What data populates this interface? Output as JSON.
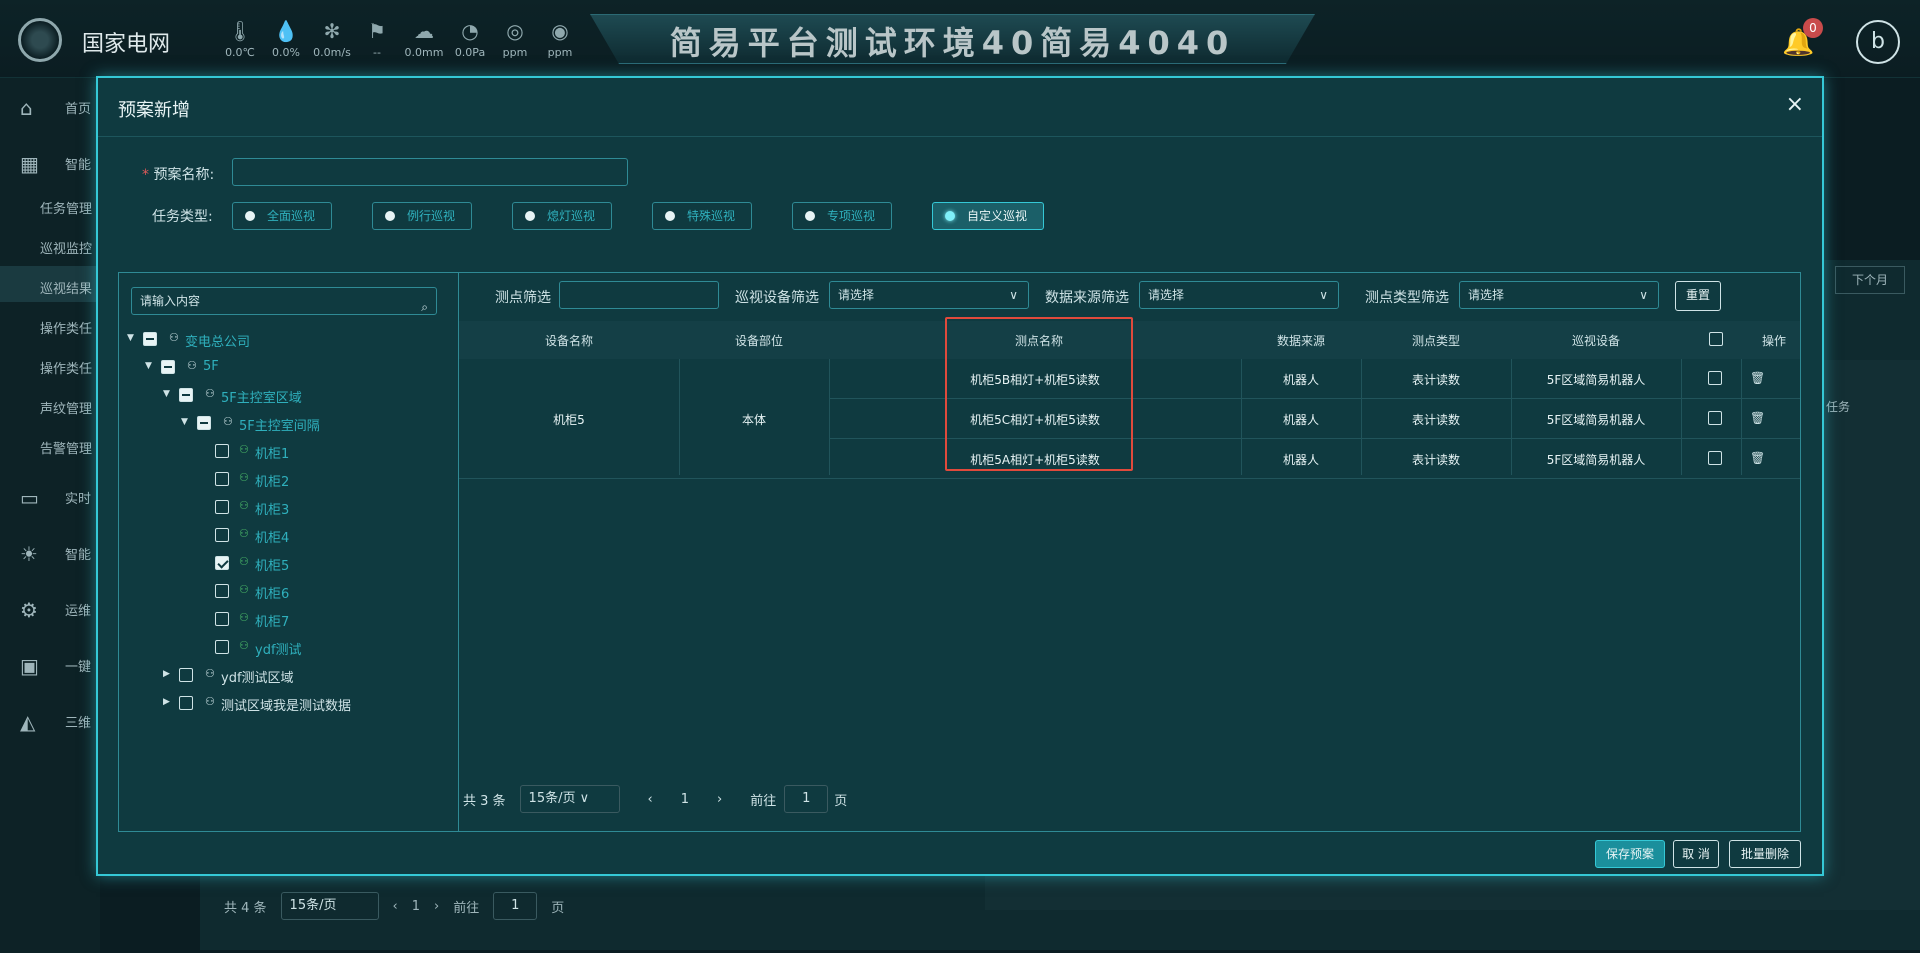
{
  "topbar": {
    "brand": "国家电网",
    "weather": [
      {
        "icon": "thermometer-icon",
        "value": "0.0℃"
      },
      {
        "icon": "humidity-icon",
        "value": "0.0%"
      },
      {
        "icon": "wind-icon",
        "value": "0.0m/s"
      },
      {
        "icon": "wind-direction-icon",
        "value": "--"
      },
      {
        "icon": "rain-icon",
        "value": "0.0mm"
      },
      {
        "icon": "pressure-icon",
        "value": "0.0Pa"
      },
      {
        "icon": "gas-icon",
        "value": "ppm"
      },
      {
        "icon": "sf6-icon",
        "value": "ppm"
      }
    ],
    "banner": "简易平台测试环境40简易4040",
    "notifications": "0",
    "avatar": "b"
  },
  "sidebar": {
    "items": [
      {
        "icon": "home-icon",
        "label": "首页"
      },
      {
        "icon": "grid-icon",
        "label": "智能"
      },
      {
        "icon": "monitor-icon",
        "label": "实时"
      },
      {
        "icon": "bulb-icon",
        "label": "智能"
      },
      {
        "icon": "gears-icon",
        "label": "运维"
      },
      {
        "icon": "id-card-icon",
        "label": "一键"
      },
      {
        "icon": "3d-icon",
        "label": "三维"
      }
    ],
    "subs": [
      "任务管理",
      "巡视监控",
      "巡视结果",
      "操作类任",
      "操作类任",
      "声纹管理",
      "告警管理"
    ]
  },
  "background": {
    "next_month": "下个月",
    "task": "任务",
    "total": "共 4 条",
    "page_size": "15条/页",
    "page": "1",
    "goto": "前往",
    "goto_val": "1",
    "page_unit": "页"
  },
  "modal": {
    "title": "预案新增",
    "close": "×",
    "plan_name_label": "预案名称:",
    "plan_name_value": "",
    "task_type_label": "任务类型:",
    "task_types": [
      {
        "label": "全面巡视",
        "selected": false
      },
      {
        "label": "例行巡视",
        "selected": false
      },
      {
        "label": "熄灯巡视",
        "selected": false
      },
      {
        "label": "特殊巡视",
        "selected": false
      },
      {
        "label": "专项巡视",
        "selected": false
      },
      {
        "label": "自定义巡视",
        "selected": true
      }
    ],
    "tree": {
      "search_placeholder": "请输入内容",
      "nodes": [
        {
          "label": "变电总公司"
        },
        {
          "label": "5F"
        },
        {
          "label": "5F主控室区域"
        },
        {
          "label": "5F主控室间隔"
        },
        {
          "label": "机柜1"
        },
        {
          "label": "机柜2"
        },
        {
          "label": "机柜3"
        },
        {
          "label": "机柜4"
        },
        {
          "label": "机柜5"
        },
        {
          "label": "机柜6"
        },
        {
          "label": "机柜7"
        },
        {
          "label": "ydf测试"
        },
        {
          "label": "ydf测试区域"
        },
        {
          "label": "测试区域我是测试数据"
        }
      ]
    },
    "filters": {
      "point_label": "测点筛选",
      "point_value": "",
      "device_label": "巡视设备筛选",
      "device_value": "请选择",
      "source_label": "数据来源筛选",
      "source_value": "请选择",
      "type_label": "测点类型筛选",
      "type_value": "请选择",
      "reset": "重置"
    },
    "table": {
      "headers": [
        "设备名称",
        "设备部位",
        "测点名称",
        "数据来源",
        "测点类型",
        "巡视设备",
        "操作"
      ],
      "device_name": "机柜5",
      "device_part": "本体",
      "rows": [
        {
          "point": "机柜5B相灯+机柜5读数",
          "source": "机器人",
          "type": "表计读数",
          "device": "5F区域简易机器人"
        },
        {
          "point": "机柜5C相灯+机柜5读数",
          "source": "机器人",
          "type": "表计读数",
          "device": "5F区域简易机器人"
        },
        {
          "point": "机柜5A相灯+机柜5读数",
          "source": "机器人",
          "type": "表计读数",
          "device": "5F区域简易机器人"
        }
      ]
    },
    "pagination": {
      "total": "共 3 条",
      "page_size": "15条/页",
      "page": "1",
      "goto": "前往",
      "goto_val": "1",
      "page_unit": "页"
    },
    "footer": {
      "save": "保存预案",
      "cancel": "取 消",
      "batch_delete": "批量删除"
    }
  }
}
